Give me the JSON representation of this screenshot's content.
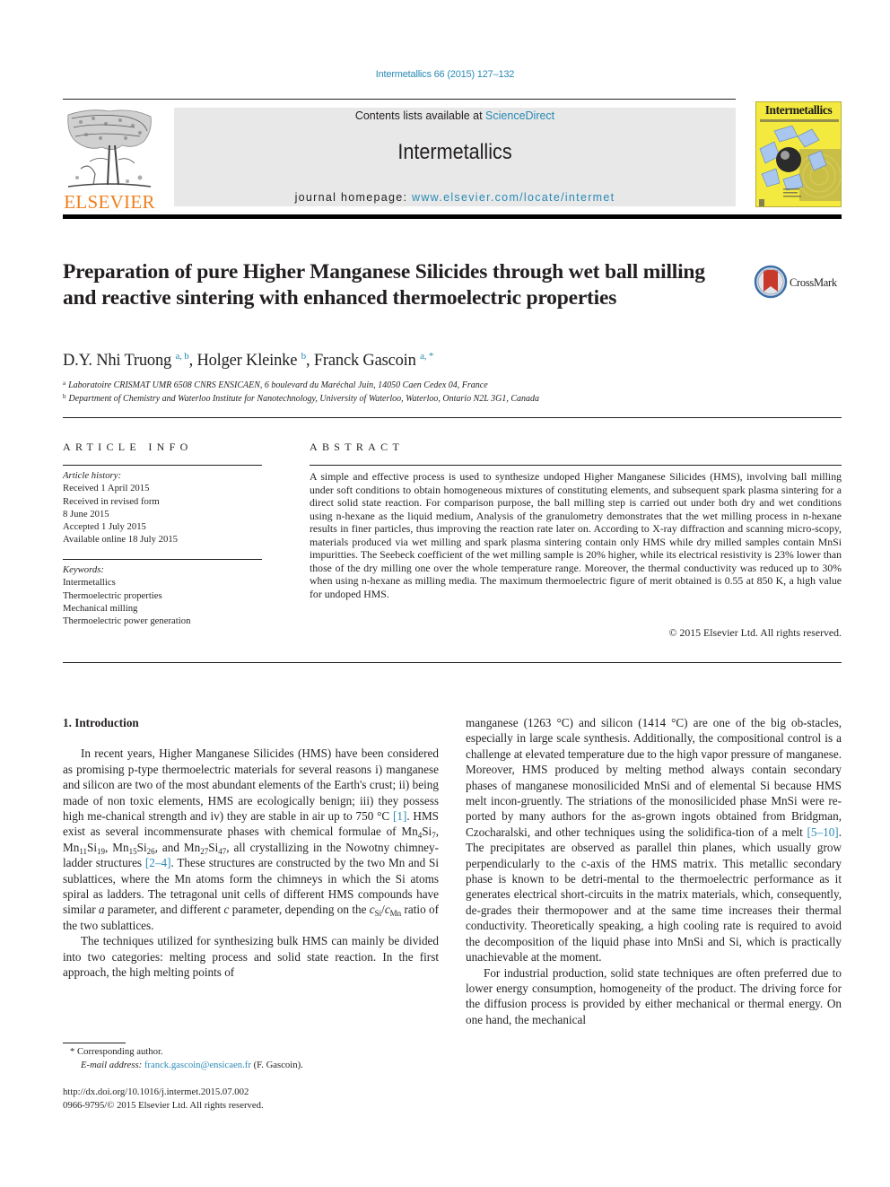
{
  "header": {
    "citation": "Intermetallics 66 (2015) 127–132",
    "contents_prefix": "Contents lists available at ",
    "contents_link": "ScienceDirect",
    "journal_name": "Intermetallics",
    "homepage_prefix": "journal homepage: ",
    "homepage_link": "www.elsevier.com/locate/intermet",
    "publisher_logo_text": "ELSEVIER",
    "cover_title": "Intermetallics",
    "colors": {
      "link": "#2a8ab5",
      "elsevier_orange": "#f07f1e",
      "cover_yellow": "#f4ea3f",
      "masthead_gray": "#e8e8e8"
    }
  },
  "article": {
    "title": "Preparation of pure Higher Manganese Silicides through wet ball milling and reactive sintering with enhanced thermoelectric properties",
    "crossmark_label": "CrossMark",
    "authors": [
      {
        "name": "D.Y. Nhi Truong",
        "affil": "a, b"
      },
      {
        "name": "Holger Kleinke",
        "affil": "b"
      },
      {
        "name": "Franck Gascoin",
        "affil": "a, *"
      }
    ],
    "affiliations": [
      {
        "mark": "a",
        "text": "Laboratoire CRISMAT UMR 6508 CNRS ENSICAEN, 6 boulevard du Maréchal Juin, 14050 Caen Cedex 04, France"
      },
      {
        "mark": "b",
        "text": "Department of Chemistry and Waterloo Institute for Nanotechnology, University of Waterloo, Waterloo, Ontario N2L 3G1, Canada"
      }
    ]
  },
  "article_info": {
    "heading": "ARTICLE INFO",
    "history_label": "Article history:",
    "history": [
      "Received 1 April 2015",
      "Received in revised form",
      "8 June 2015",
      "Accepted 1 July 2015",
      "Available online 18 July 2015"
    ],
    "keywords_label": "Keywords:",
    "keywords": [
      "Intermetallics",
      "Thermoelectric properties",
      "Mechanical milling",
      "Thermoelectric power generation"
    ]
  },
  "abstract": {
    "heading": "ABSTRACT",
    "text": "A simple and effective process is used to synthesize undoped Higher Manganese Silicides (HMS), involving ball milling under soft conditions to obtain homogeneous mixtures of constituting elements, and subsequent spark plasma sintering for a direct solid state reaction. For comparison purpose, the ball milling step is carried out under both dry and wet conditions using n-hexane as the liquid medium, Analysis of the granulometry demonstrates that the wet milling process in n-hexane results in finer particles, thus improving the reaction rate later on. According to X-ray diffraction and scanning micro-scopy, materials produced via wet milling and spark plasma sintering contain only HMS while dry milled samples contain MnSi impuritties. The Seebeck coefficient of the wet milling sample is 20% higher, while its electrical resistivity is 23% lower than those of the dry milling one over the whole temperature range. Moreover, the thermal conductivity was reduced up to 30% when using n-hexane as milling media. The maximum thermoelectric figure of merit obtained is 0.55 at 850 K, a high value for undoped HMS.",
    "copyright": "© 2015 Elsevier Ltd. All rights reserved."
  },
  "body": {
    "section_heading": "1.  Introduction",
    "left": {
      "p1_a": "In recent years, Higher Manganese Silicides (HMS) have been considered as promising p-type thermoelectric materials for several reasons i) manganese and silicon are two of the most abundant elements of the Earth's crust; ii) being made of non toxic elements, HMS are ecologically benign; iii) they possess high me-chanical strength and iv) they are stable in air up to 750 °C ",
      "ref1": "[1]",
      "p1_b": ". HMS exist as several incommensurate phases with chemical formulae of ",
      "formulae": [
        {
          "el1": "Mn",
          "n1": "4",
          "el2": "Si",
          "n2": "7",
          "sep": ", "
        },
        {
          "el1": "Mn",
          "n1": "11",
          "el2": "Si",
          "n2": "19",
          "sep": ", "
        },
        {
          "el1": "Mn",
          "n1": "15",
          "el2": "Si",
          "n2": "26",
          "sep": ", and "
        },
        {
          "el1": "Mn",
          "n1": "27",
          "el2": "Si",
          "n2": "47",
          "sep": ""
        }
      ],
      "p1_c": ", all crystallizing in the Nowotny chimney-ladder structures ",
      "ref2": "[2–4]",
      "p1_d": ". These structures are constructed by the two Mn and Si sublattices, where the Mn atoms form the chimneys in which the Si atoms spiral as ladders. The tetragonal unit cells of different HMS compounds have similar ",
      "var_a": "a",
      "p1_e": " parameter, and different ",
      "var_c": "c",
      "p1_f": " parameter, depending on the ",
      "ratio_c1": "c",
      "ratio_s1": "Si",
      "ratio_slash": "/",
      "ratio_c2": "c",
      "ratio_s2": "Mn",
      "p1_g": " ratio of the two sublattices.",
      "p2": "The techniques utilized for synthesizing bulk HMS can mainly be divided into two categories: melting process and solid state reaction. In the first approach, the high melting points of"
    },
    "right": {
      "p1_a": "manganese (1263 °C) and silicon (1414 °C) are one of the big ob-stacles, especially in large scale synthesis. Additionally, the compositional control is a challenge at elevated temperature due to the high vapor pressure of manganese. Moreover, HMS produced by melting method always contain secondary phases of manganese monosilicided MnSi and of elemental Si because HMS melt incon-gruently. The striations of the monosilicided phase MnSi were re-ported by many authors for the as-grown ingots obtained from Bridgman, Czocharalski, and other techniques using the solidifica-tion of a melt ",
      "ref": "[5–10]",
      "p1_b": ". The precipitates are observed as parallel thin planes, which usually grow perpendicularly to the c-axis of the HMS matrix. This metallic secondary phase is known to be detri-mental to the thermoelectric performance as it generates electrical short-circuits in the matrix materials, which, consequently, de-grades their thermopower and at the same time increases their thermal conductivity. Theoretically speaking, a high cooling rate is required to avoid the decomposition of the liquid phase into MnSi and Si, which is practically unachievable at the moment.",
      "p2": "For industrial production, solid state techniques are often preferred due to lower energy consumption, homogeneity of the product. The driving force for the diffusion process is provided by either mechanical or thermal energy. On one hand, the mechanical"
    }
  },
  "footer": {
    "corresponding": "* Corresponding author.",
    "email_label": "E-mail address: ",
    "email": "franck.gascoin@ensicaen.fr",
    "email_suffix": " (F. Gascoin).",
    "doi": "http://dx.doi.org/10.1016/j.intermet.2015.07.002",
    "issn": "0966-9795/© 2015 Elsevier Ltd. All rights reserved."
  }
}
